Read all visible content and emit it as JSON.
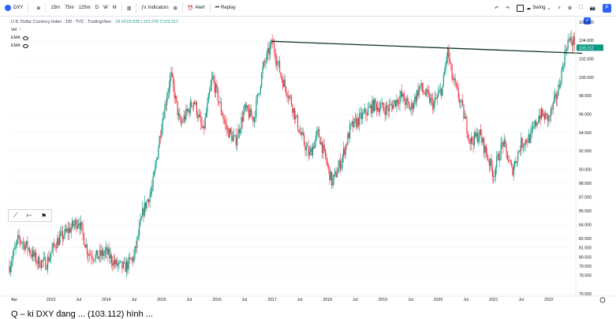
{
  "toolbar": {
    "symbol": "DXY",
    "intervals": [
      "15m",
      "75m",
      "125m",
      "D",
      "W",
      "M"
    ],
    "indicators_label": "Indicators",
    "alert_label": "Alert",
    "replay_label": "Replay",
    "layout_label": "Swing"
  },
  "legend": {
    "title": "U.S. Dollar Currency Index · 1W · TVC · TradingView",
    "ohlc": "18  H103.928  L101.040  C103.212",
    "indicators": [
      "Vol",
      "EMA",
      "EMA"
    ]
  },
  "caption": "Q – ki DXY đang ... (103.112) hình ... ",
  "chart_data": {
    "type": "candlestick",
    "title": "U.S. Dollar Currency Index, 1W, TVC",
    "ylim": [
      76.5,
      106.5
    ],
    "y_ticks": [
      76.5,
      78.5,
      79.5,
      80.5,
      81.5,
      82.5,
      84.0,
      85.5,
      87.0,
      88.5,
      90.0,
      92.0,
      94.0,
      96.0,
      98.0,
      100.0,
      102.0,
      104.0,
      106.0
    ],
    "x_ticks": [
      "Apr",
      "2013",
      "Jul",
      "2014",
      "Jul",
      "2015",
      "Jul",
      "2016",
      "Jul",
      "2017",
      "Jul",
      "2018",
      "Jul",
      "2019",
      "Jul",
      "2020",
      "Jul",
      "2021",
      "Jul",
      "2022"
    ],
    "last_price": "103.212",
    "anchors": [
      [
        "2012-04",
        79.5
      ],
      [
        "2012-06",
        82.5
      ],
      [
        "2012-08",
        81.5
      ],
      [
        "2012-10",
        80.0
      ],
      [
        "2012-12",
        79.8
      ],
      [
        "2013-02",
        82.0
      ],
      [
        "2013-04",
        83.0
      ],
      [
        "2013-07",
        84.5
      ],
      [
        "2013-09",
        81.0
      ],
      [
        "2013-11",
        80.5
      ],
      [
        "2014-01",
        81.0
      ],
      [
        "2014-03",
        79.7
      ],
      [
        "2014-05",
        79.3
      ],
      [
        "2014-07",
        80.5
      ],
      [
        "2014-09",
        85.5
      ],
      [
        "2014-11",
        88.0
      ],
      [
        "2015-01",
        95.0
      ],
      [
        "2015-03",
        100.3
      ],
      [
        "2015-05",
        94.8
      ],
      [
        "2015-08",
        97.5
      ],
      [
        "2015-10",
        94.0
      ],
      [
        "2015-12",
        100.0
      ],
      [
        "2016-03",
        94.5
      ],
      [
        "2016-05",
        93.0
      ],
      [
        "2016-07",
        96.5
      ],
      [
        "2016-09",
        95.5
      ],
      [
        "2016-11",
        101.0
      ],
      [
        "2017-01",
        103.8
      ],
      [
        "2017-03",
        100.0
      ],
      [
        "2017-05",
        97.5
      ],
      [
        "2017-07",
        94.0
      ],
      [
        "2017-09",
        91.5
      ],
      [
        "2017-11",
        94.0
      ],
      [
        "2018-02",
        88.5
      ],
      [
        "2018-04",
        91.0
      ],
      [
        "2018-06",
        94.5
      ],
      [
        "2018-08",
        95.5
      ],
      [
        "2018-11",
        97.0
      ],
      [
        "2019-02",
        96.5
      ],
      [
        "2019-05",
        98.0
      ],
      [
        "2019-07",
        96.5
      ],
      [
        "2019-09",
        99.0
      ],
      [
        "2019-12",
        97.0
      ],
      [
        "2020-02",
        99.0
      ],
      [
        "2020-03",
        103.0
      ],
      [
        "2020-04",
        100.0
      ],
      [
        "2020-06",
        97.0
      ],
      [
        "2020-08",
        93.0
      ],
      [
        "2020-10",
        93.8
      ],
      [
        "2021-01",
        89.5
      ],
      [
        "2021-03",
        93.0
      ],
      [
        "2021-05",
        89.8
      ],
      [
        "2021-07",
        92.8
      ],
      [
        "2021-09",
        93.5
      ],
      [
        "2021-11",
        96.0
      ],
      [
        "2022-01",
        95.5
      ],
      [
        "2022-03",
        98.5
      ],
      [
        "2022-05",
        103.9
      ]
    ],
    "trendline": {
      "from": [
        "2017-01",
        103.9
      ],
      "to": [
        "2022-05",
        102.6
      ]
    }
  }
}
